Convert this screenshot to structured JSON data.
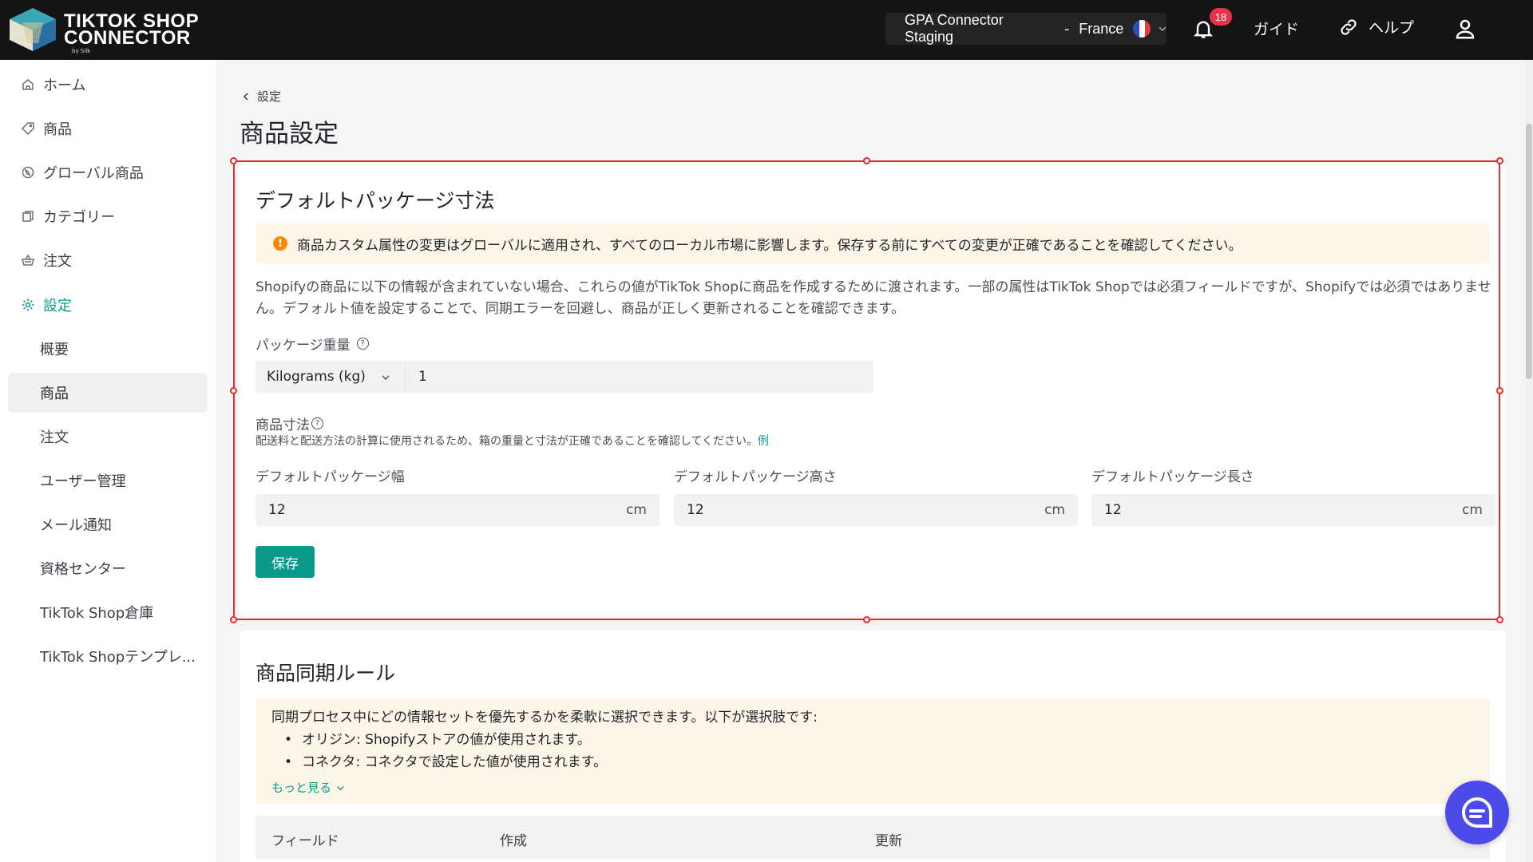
{
  "header": {
    "logo_line1": "TIKTOK SHOP",
    "logo_line2": "CONNECTOR",
    "logo_by": "by Silk",
    "store_name": "GPA Connector Staging",
    "store_sep": "-",
    "store_region": "France",
    "notification_count": "18",
    "guide_label": "ガイド",
    "help_label": "ヘルプ"
  },
  "sidebar": {
    "items": [
      {
        "label": "ホーム",
        "icon": "home-icon"
      },
      {
        "label": "商品",
        "icon": "tag-icon"
      },
      {
        "label": "グローバル商品",
        "icon": "globe-icon"
      },
      {
        "label": "カテゴリー",
        "icon": "copy-icon"
      },
      {
        "label": "注文",
        "icon": "basket-icon"
      },
      {
        "label": "設定",
        "icon": "gear-icon"
      }
    ],
    "sub_items": [
      {
        "label": "概要"
      },
      {
        "label": "商品"
      },
      {
        "label": "注文"
      },
      {
        "label": "ユーザー管理"
      },
      {
        "label": "メール通知"
      },
      {
        "label": "資格センター"
      },
      {
        "label": "TikTok Shop倉庫"
      },
      {
        "label": "TikTok Shopテンプレ..."
      }
    ]
  },
  "main": {
    "breadcrumb": "設定",
    "title": "商品設定",
    "package": {
      "title": "デフォルトパッケージ寸法",
      "warning": "商品カスタム属性の変更はグローバルに適用され、すべてのローカル市場に影響します。保存する前にすべての変更が正確であることを確認してください。",
      "description": "Shopifyの商品に以下の情報が含まれていない場合、これらの値がTikTok Shopに商品を作成するために渡されます。一部の属性はTikTok Shopでは必須フィールドですが、Shopifyでは必須ではありません。デフォルト値を設定することで、同期エラーを回避し、商品が正しく更新されることを確認できます。",
      "weight_label": "パッケージ重量",
      "weight_unit": "Kilograms (kg)",
      "weight_value": "1",
      "dims_label": "商品寸法",
      "dims_desc": "配送料と配送方法の計算に使用されるため、箱の重量と寸法が正確であることを確認してください。",
      "dims_example": "例",
      "width_label": "デフォルトパッケージ幅",
      "height_label": "デフォルトパッケージ高さ",
      "length_label": "デフォルトパッケージ長さ",
      "width_value": "12",
      "height_value": "12",
      "length_value": "12",
      "dim_unit": "cm",
      "save_label": "保存"
    },
    "sync": {
      "title": "商品同期ルール",
      "intro": "同期プロセス中にどの情報セットを優先するかを柔軟に選択できます。以下が選択肢です:",
      "option1": "オリジン:  Shopifyストアの値が使用されます。",
      "option2": "コネクタ:  コネクタで設定した値が使用されます。",
      "more": "もっと見る",
      "columns": [
        "フィールド",
        "作成",
        "更新"
      ]
    }
  },
  "colors": {
    "accent": "#0a9a8c",
    "topbar": "#141414",
    "badge": "#e8344b",
    "warning_bg": "#fdf6e8",
    "chat": "#4c4ae8",
    "selection": "#e8282b"
  }
}
